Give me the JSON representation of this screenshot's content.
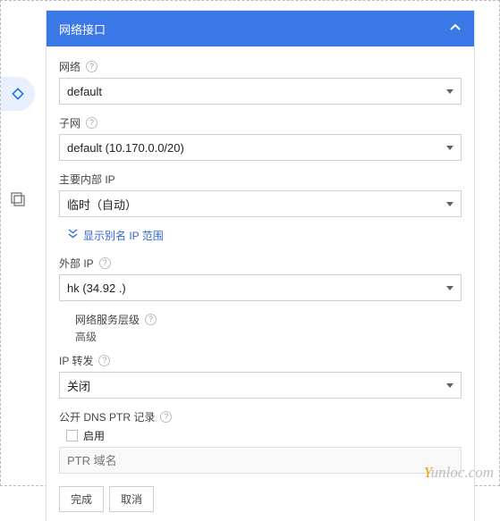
{
  "header": {
    "title": "网络接口"
  },
  "network": {
    "label": "网络",
    "value": "default"
  },
  "subnet": {
    "label": "子网",
    "value": "default (10.170.0.0/20)"
  },
  "primary_internal_ip": {
    "label": "主要内部 IP",
    "value": "临时（自动）"
  },
  "alias_ip": {
    "expand_label": "显示别名 IP 范围"
  },
  "external_ip": {
    "label": "外部 IP",
    "value": "hk (34.92            .)"
  },
  "network_tier": {
    "label": "网络服务层级",
    "value": "高级"
  },
  "ip_forward": {
    "label": "IP 转发",
    "value": "关闭"
  },
  "ptr": {
    "label": "公开 DNS PTR 记录",
    "enable_label": "启用",
    "placeholder": "PTR 域名"
  },
  "actions": {
    "done": "完成",
    "cancel": "取消"
  },
  "watermark": {
    "y": "Y",
    "rest": "unloc.com"
  }
}
